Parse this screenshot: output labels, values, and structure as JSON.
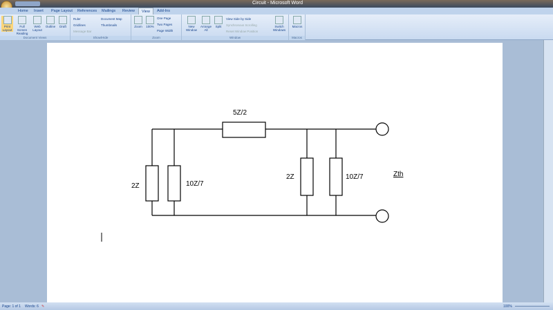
{
  "window": {
    "title": "Circuit - Microsoft Word"
  },
  "tabs": [
    "Home",
    "Insert",
    "Page Layout",
    "References",
    "Mailings",
    "Review",
    "View",
    "Add-Ins"
  ],
  "active_tab": "View",
  "ribbon": {
    "document_views": {
      "label": "Document Views",
      "buttons": [
        "Print Layout",
        "Full Screen Reading",
        "Web Layout",
        "Outline",
        "Draft"
      ]
    },
    "show_hide": {
      "label": "Show/Hide",
      "items": [
        "Ruler",
        "Gridlines",
        "Message Bar",
        "Document Map",
        "Thumbnails"
      ]
    },
    "zoom": {
      "label": "Zoom",
      "buttons": [
        "Zoom",
        "100%",
        "One Page",
        "Two Pages",
        "Page Width"
      ]
    },
    "window": {
      "label": "Window",
      "buttons": [
        "New Window",
        "Arrange All",
        "Split",
        "View Side by Side",
        "Synchronous Scrolling",
        "Reset Window Position",
        "Switch Windows"
      ]
    },
    "macros": {
      "label": "Macros",
      "buttons": [
        "Macros"
      ]
    }
  },
  "circuit": {
    "series": "5Z/2",
    "left_a": "2Z",
    "left_b": "10Z/7",
    "right_a": "2Z",
    "right_b": "10Z/7",
    "output": "Zth"
  },
  "status": {
    "page": "Page: 1 of 1",
    "words": "Words: 6",
    "zoom": "100%"
  }
}
